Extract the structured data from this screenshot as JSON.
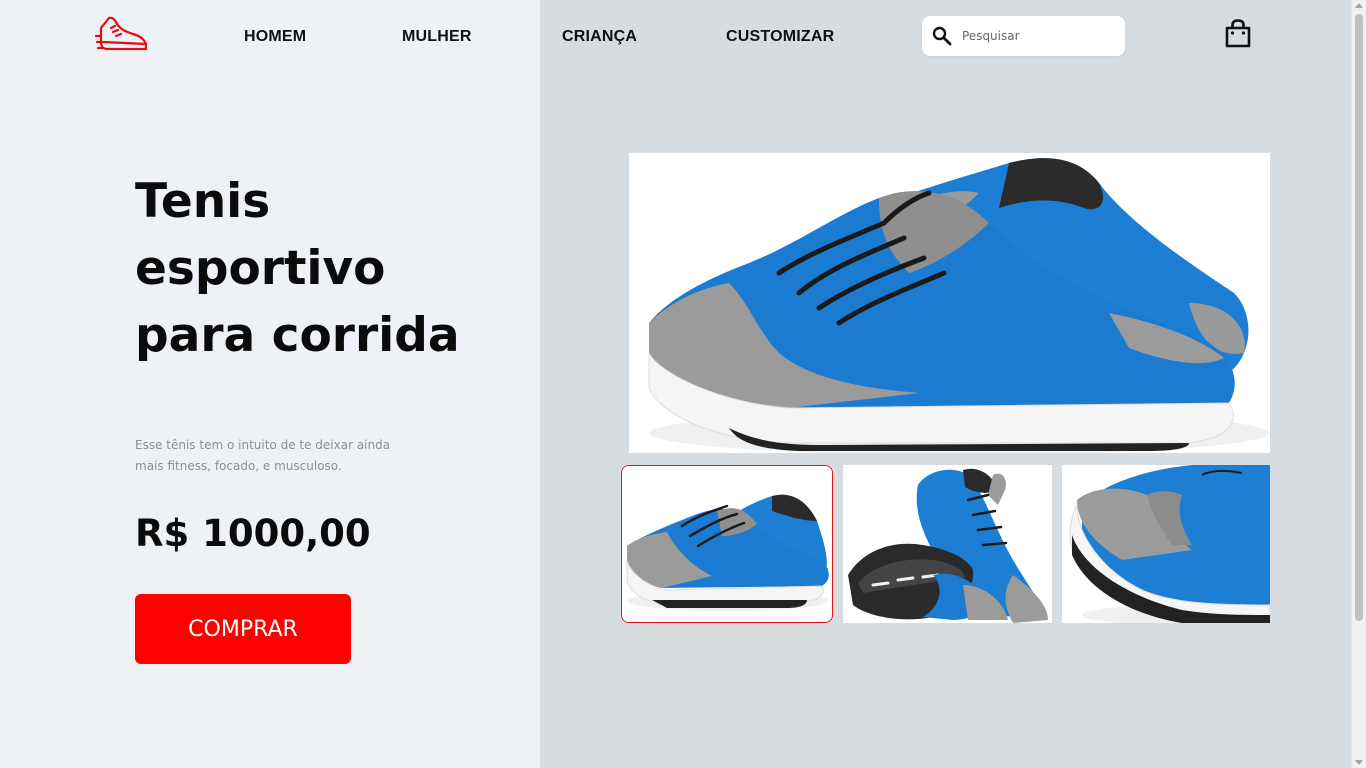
{
  "header": {
    "logo_icon": "running-shoe-icon",
    "nav": [
      {
        "label": "HOMEM"
      },
      {
        "label": "MULHER"
      },
      {
        "label": "CRIANÇA"
      },
      {
        "label": "CUSTOMIZAR"
      }
    ],
    "search": {
      "placeholder": "Pesquisar",
      "icon": "search-icon"
    },
    "cart_icon": "shopping-bag-icon"
  },
  "product": {
    "title": "Tenis esportivo para corrida",
    "description": "Esse tênis tem o intuito de te deixar ainda mais fitness, focado, e musculoso.",
    "price": "R$ 1000,00",
    "buy_label": "COMPRAR"
  },
  "gallery": {
    "main_image": "blue running shoes pair",
    "thumbnails": [
      {
        "name": "pair-side-view",
        "selected": true
      },
      {
        "name": "pair-top-view",
        "selected": false
      },
      {
        "name": "closeup-heel-view",
        "selected": false
      }
    ]
  },
  "colors": {
    "accent": "#ff0000",
    "left_bg": "#eef2f6",
    "right_bg": "#d6dce0",
    "shoe_blue": "#1d7fd3"
  }
}
